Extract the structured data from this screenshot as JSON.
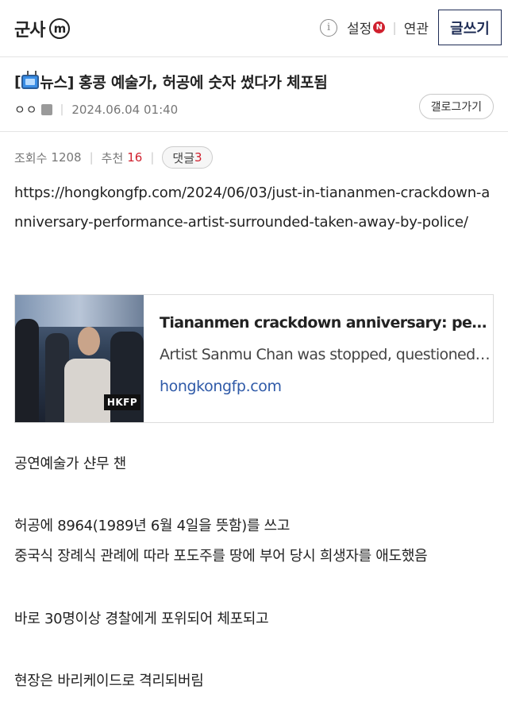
{
  "header": {
    "brand": "군사",
    "brand_badge": "m",
    "info_symbol": "i",
    "settings_label": "설정",
    "settings_badge": "N",
    "related_label": "연관",
    "write_label": "글쓰기"
  },
  "post": {
    "title_prefix": "[",
    "title_category": "뉴스]",
    "title_text": "홍콩 예술가, 허공에 숫자 썼다가 체포됨",
    "author": "ㅇㅇ",
    "date": "2024.06.04 01:40",
    "gallery_button": "갤로그가기",
    "views_label": "조회수",
    "views": "1208",
    "likes_label": "추천",
    "likes": "16",
    "comments_label": "댓글",
    "comments": "3"
  },
  "body": {
    "url": "https://hongkongfp.com/2024/06/03/just-in-tiananmen-crackdown-anniversary-performance-artist-surrounded-taken-away-by-police/",
    "link_card": {
      "title": "Tiananmen crackdown anniversary: performance artist surrounded, taken away by police",
      "description": "Artist Sanmu Chan was stopped, questioned and taken away by police",
      "domain": "hongkongfp.com",
      "image_watermark": "HKFP"
    },
    "paragraphs": [
      "공연예술가 샨무 챈",
      "허공에 8964(1989년 6월 4일을 뜻함)를 쓰고",
      "중국식 장례식 관례에 따라 포도주를 땅에 부어 당시 희생자를 애도했음",
      "바로 30명이상 경찰에게 포위되어 체포되고",
      "현장은 바리케이드로 격리되버림"
    ]
  },
  "colors": {
    "accent_navy": "#1e2c55",
    "highlight_red": "#d0202e",
    "link_blue": "#2f5aa8"
  }
}
